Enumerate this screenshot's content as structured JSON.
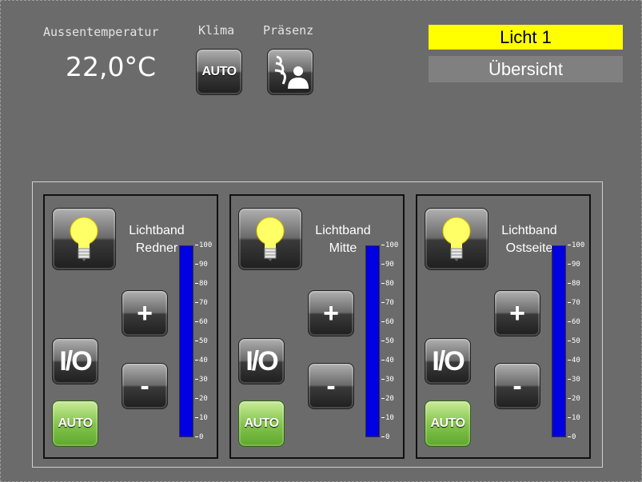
{
  "header": {
    "outside_temp_label": "Aussentemperatur",
    "outside_temp_value": "22,0°C",
    "klima_label": "Klima",
    "klima_button": "AUTO",
    "presence_label": "Präsenz",
    "title": "Licht 1",
    "overview_button": "Übersicht"
  },
  "colors": {
    "background": "#6b6b6b",
    "title_bg": "#ffff00",
    "overview_bg": "#808080",
    "bar_fill": "#0000e0",
    "auto_green": "#86c54e"
  },
  "scale_ticks": [
    "100",
    "90",
    "80",
    "70",
    "60",
    "50",
    "40",
    "30",
    "20",
    "10",
    "0"
  ],
  "panels": [
    {
      "title_line1": "Lichtband",
      "title_line2": "Redner",
      "plus": "+",
      "minus": "-",
      "io": "I/O",
      "auto": "AUTO",
      "level": 100
    },
    {
      "title_line1": "Lichtband",
      "title_line2": "Mitte",
      "plus": "+",
      "minus": "-",
      "io": "I/O",
      "auto": "AUTO",
      "level": 100
    },
    {
      "title_line1": "Lichtband",
      "title_line2": "Ostseite",
      "plus": "+",
      "minus": "-",
      "io": "I/O",
      "auto": "AUTO",
      "level": 100
    }
  ],
  "icons": {
    "bulb": "light-bulb-icon",
    "presence": "presence-sensor-icon"
  }
}
